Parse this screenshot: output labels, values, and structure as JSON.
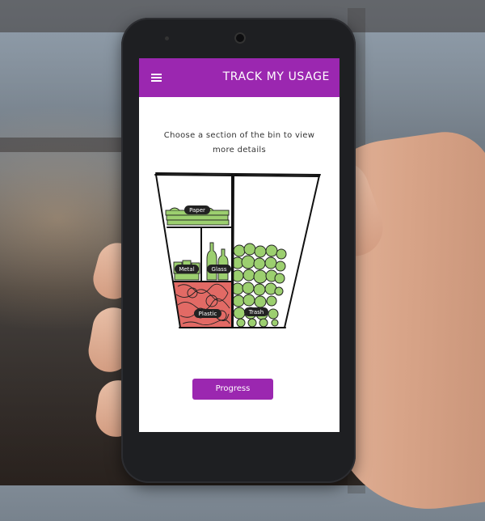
{
  "appbar": {
    "title": "TRACK MY USAGE",
    "menu_icon": "hamburger-menu-icon",
    "color": "#9b27b0"
  },
  "instruction": "Choose a section of the bin to view more details",
  "bin_sections": {
    "paper": "Paper",
    "metal": "Metal",
    "glass": "Glass",
    "plastic": "Plastic",
    "trash": "Trash"
  },
  "colors": {
    "green_fill": "#9ccf6f",
    "red_fill": "#e26a65"
  },
  "progress_button": "Progress"
}
